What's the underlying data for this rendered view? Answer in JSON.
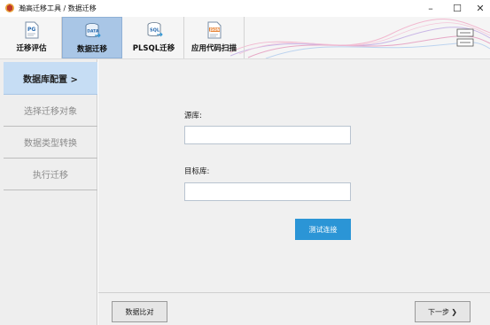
{
  "window": {
    "title": "瀚高迁移工具 / 数据迁移",
    "minimize": "–",
    "maximize": "☐",
    "close": "✕"
  },
  "toolbar": {
    "items": [
      {
        "label": "迁移评估",
        "icon": "pg-document-icon",
        "active": false
      },
      {
        "label": "数据迁移",
        "icon": "database-data-icon",
        "active": true
      },
      {
        "label": "PLSQL迁移",
        "icon": "sql-database-icon",
        "active": false
      },
      {
        "label": "应用代码扫描",
        "icon": "json-scan-icon",
        "active": false
      }
    ],
    "menu_icon": "menu-icon"
  },
  "sidebar": {
    "items": [
      {
        "label": "数据库配置 >",
        "active": true
      },
      {
        "label": "选择迁移对象",
        "active": false
      },
      {
        "label": "数据类型转换",
        "active": false
      },
      {
        "label": "执行迁移",
        "active": false
      }
    ]
  },
  "form": {
    "source_label": "源库:",
    "source_value": "",
    "target_label": "目标库:",
    "target_value": "",
    "test_button": "测试连接"
  },
  "footer": {
    "compare_button": "数据比对",
    "next_button": "下一步 ❯"
  },
  "colors": {
    "accent": "#2b95d6",
    "active_tab": "#a9c6e6",
    "active_side": "#c6ddf4"
  }
}
